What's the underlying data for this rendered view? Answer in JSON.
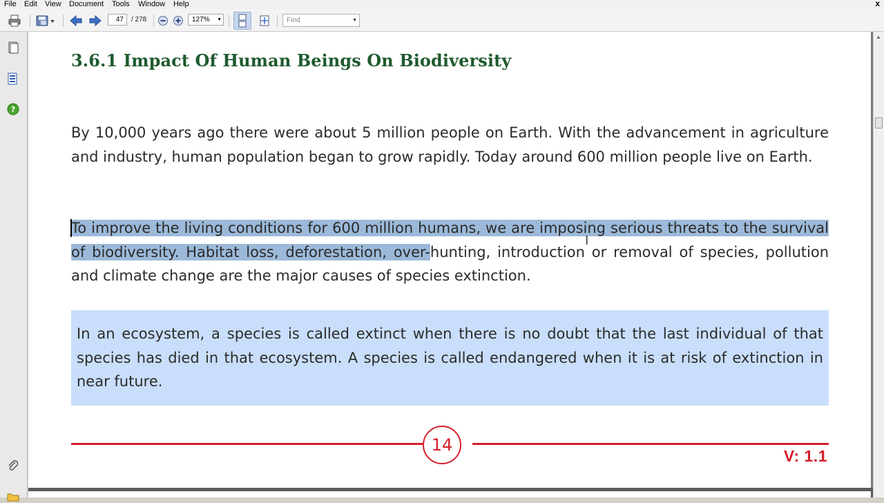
{
  "menu": {
    "items": [
      "File",
      "Edit",
      "View",
      "Document",
      "Tools",
      "Window",
      "Help"
    ],
    "close": "x"
  },
  "toolbar": {
    "current_page": "47",
    "page_total": "/ 278",
    "zoom": "127%",
    "find_placeholder": "Find"
  },
  "document": {
    "heading": "3.6.1 Impact Of Human Beings On Biodiversity",
    "paragraph1": "By 10,000 years ago there were about 5 million people on Earth. With the advancement in agriculture and industry, human population began to grow rapidly. Today around 600 million people live on Earth.",
    "paragraph2_selected": "To improve the living conditions for 600 million humans, we are imposing serious threats to the survival of biodiversity. Habitat loss, deforestation, over-",
    "paragraph2_rest": "hunting, introduction or removal of species, pollution and climate change are the major causes of species extinction.",
    "callout": "In an ecosystem, a species is called extinct when there is no doubt that the last individual of that species has died in that ecosystem. A species is called endangered when it is at risk of extinction in near future.",
    "page_number": "14",
    "version": "V: 1.1"
  },
  "colors": {
    "heading": "#1f5a2e",
    "accent_red": "#d41f2b",
    "selection": "#9cb9d9",
    "callout_bg": "#c9defb"
  },
  "icons": [
    "print-icon",
    "save-icon",
    "prev-page-icon",
    "next-page-icon",
    "zoom-out-icon",
    "zoom-in-icon",
    "page-layout-icon",
    "fit-page-icon",
    "pages-icon",
    "bookmarks-icon",
    "help-icon",
    "attachment-icon",
    "folder-icon"
  ]
}
